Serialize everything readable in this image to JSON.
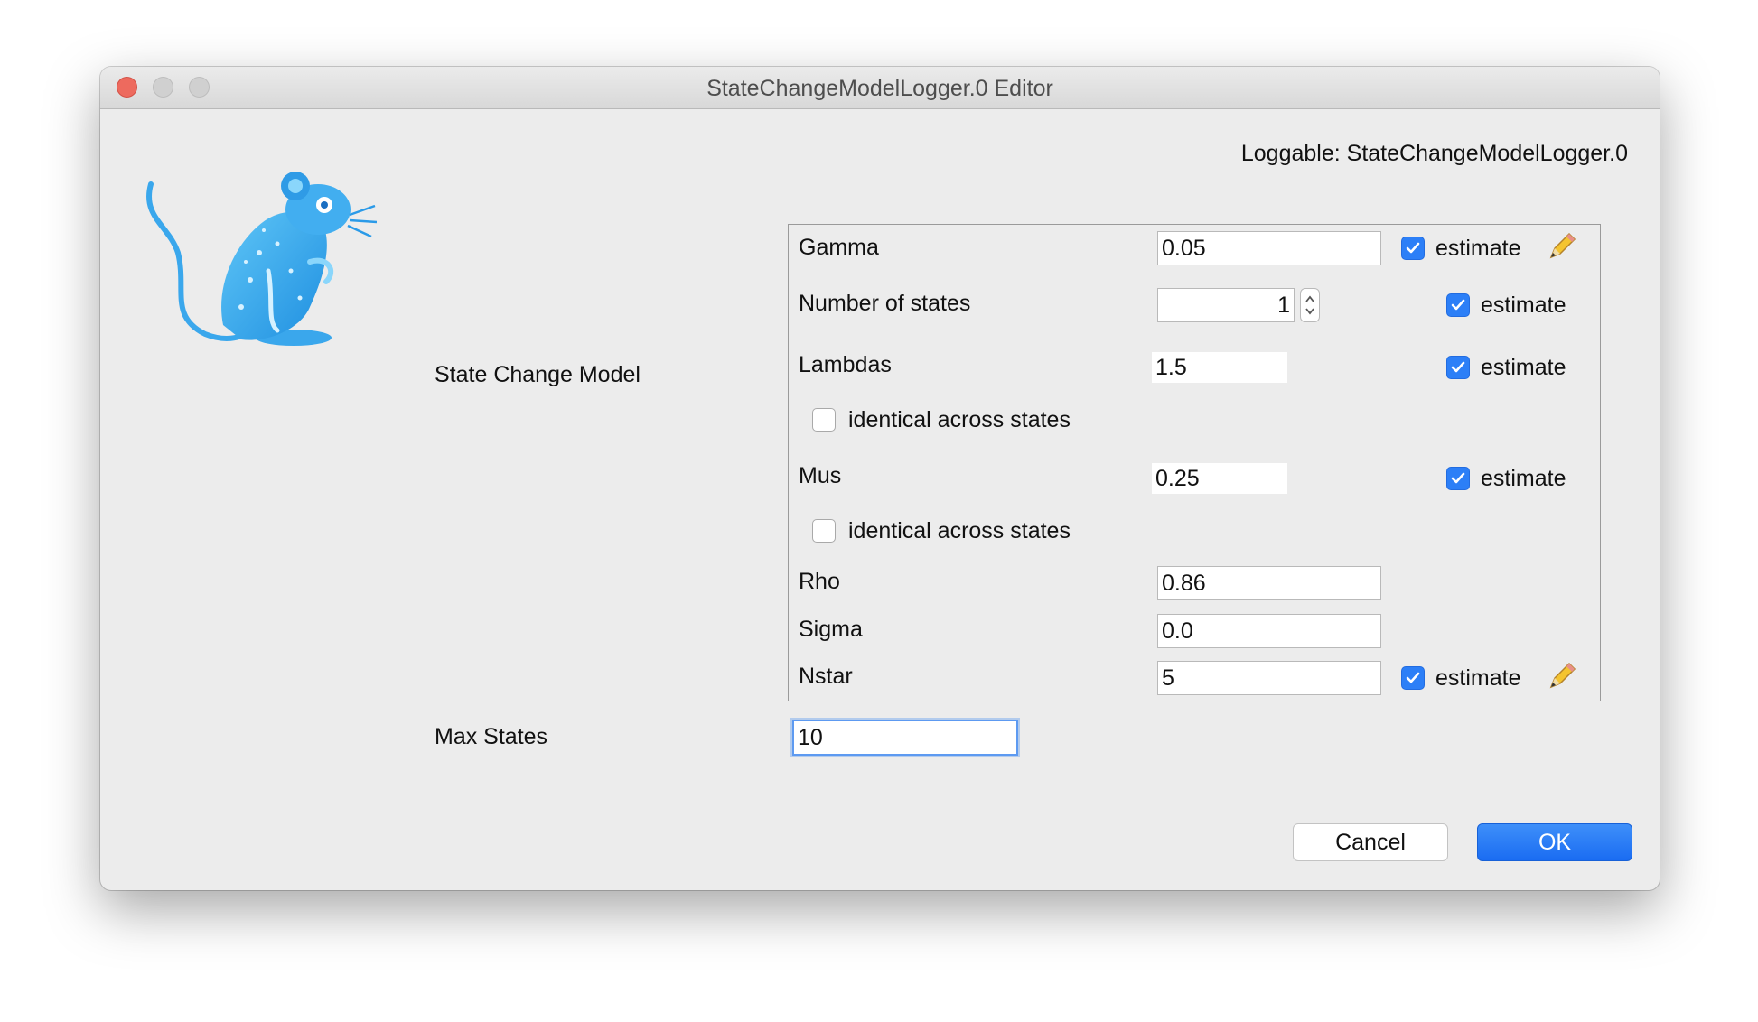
{
  "window": {
    "title": "StateChangeModelLogger.0 Editor"
  },
  "loggable_label": "Loggable: StateChangeModelLogger.0",
  "section_label": "State Change Model",
  "params": {
    "gamma": {
      "label": "Gamma",
      "value": "0.05",
      "estimate_label": "estimate",
      "estimate": true
    },
    "nstates": {
      "label": "Number of states",
      "value": "1",
      "estimate_label": "estimate",
      "estimate": true
    },
    "lambdas": {
      "label": "Lambdas",
      "value": "1.5",
      "estimate_label": "estimate",
      "estimate": true,
      "identical_label": "identical across states",
      "identical": false
    },
    "mus": {
      "label": "Mus",
      "value": "0.25",
      "estimate_label": "estimate",
      "estimate": true,
      "identical_label": "identical across states",
      "identical": false
    },
    "rho": {
      "label": "Rho",
      "value": "0.86"
    },
    "sigma": {
      "label": "Sigma",
      "value": "0.0"
    },
    "nstar": {
      "label": "Nstar",
      "value": "5",
      "estimate_label": "estimate",
      "estimate": true
    }
  },
  "max_states": {
    "label": "Max States",
    "value": "10"
  },
  "buttons": {
    "cancel": "Cancel",
    "ok": "OK"
  },
  "icons": {
    "logo": "beast-mouse-logo",
    "edit": "pencil-icon",
    "spinner": "up-down-arrows-icon"
  },
  "colors": {
    "accent": "#2c7ff7",
    "close": "#ed6a5e",
    "logo": "#37a6ec"
  }
}
